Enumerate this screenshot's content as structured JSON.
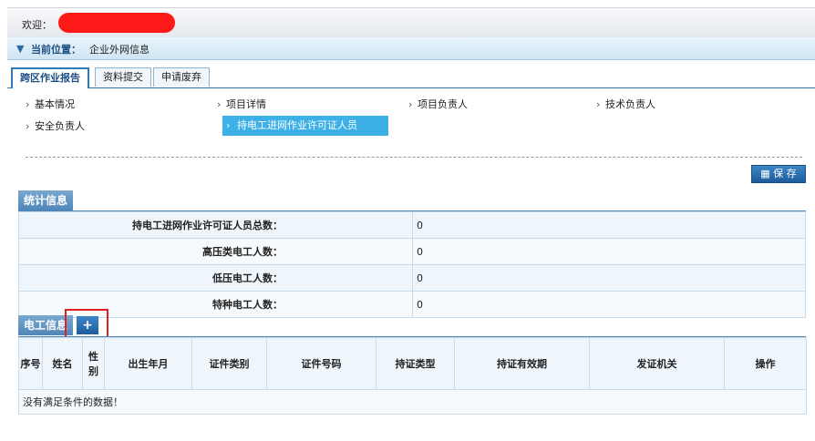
{
  "header": {
    "welcome_label": "欢迎："
  },
  "location": {
    "label": "当前位置：",
    "value": "企业外网信息"
  },
  "tabs": [
    {
      "label": "跨区作业报告"
    },
    {
      "label": "资料提交"
    },
    {
      "label": "申请废弃"
    }
  ],
  "subnav": [
    {
      "label": "基本情况"
    },
    {
      "label": "项目详情"
    },
    {
      "label": "项目负责人"
    },
    {
      "label": "技术负责人"
    },
    {
      "label": "安全负责人"
    },
    {
      "label": "持电工进网作业许可证人员"
    }
  ],
  "toolbar": {
    "save_label": "保 存"
  },
  "stats": {
    "title": "统计信息",
    "rows": [
      {
        "label": "持电工进网作业许可证人员总数：",
        "value": "0"
      },
      {
        "label": "高压类电工人数：",
        "value": "0"
      },
      {
        "label": "低压电工人数：",
        "value": "0"
      },
      {
        "label": "特种电工人数：",
        "value": "0"
      }
    ]
  },
  "electricians": {
    "title": "电工信息",
    "add_label": "+",
    "columns": [
      "序号",
      "姓名",
      "性别",
      "出生年月",
      "证件类别",
      "证件号码",
      "持证类型",
      "持证有效期",
      "发证机关",
      "操作"
    ],
    "empty_message": "没有满足条件的数据！"
  },
  "colors": {
    "accent": "#2f78b4",
    "selected_nav": "#3db0e8",
    "highlight": "#e02020"
  }
}
